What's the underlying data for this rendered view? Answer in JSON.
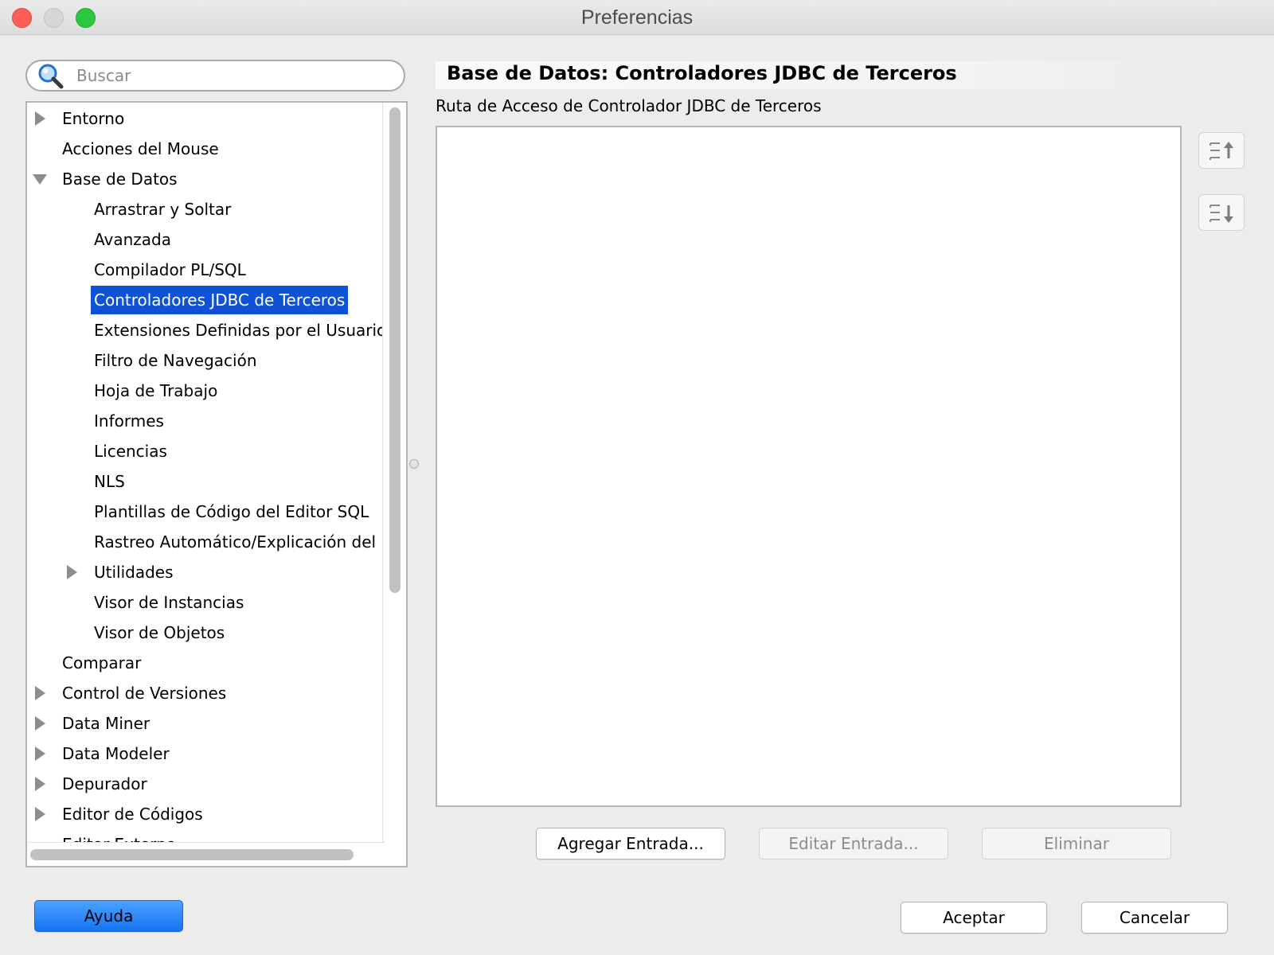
{
  "window": {
    "title": "Preferencias",
    "controls": [
      "close",
      "minimize",
      "maximize"
    ]
  },
  "search": {
    "placeholder": "Buscar",
    "value": "",
    "icon": "magnifier-icon"
  },
  "tree": {
    "items": [
      {
        "label": "Entorno",
        "level": 0,
        "expandable": true,
        "expanded": false
      },
      {
        "label": "Acciones del Mouse",
        "level": 0,
        "expandable": false
      },
      {
        "label": "Base de Datos",
        "level": 0,
        "expandable": true,
        "expanded": true
      },
      {
        "label": "Arrastrar y Soltar",
        "level": 1,
        "expandable": false
      },
      {
        "label": "Avanzada",
        "level": 1,
        "expandable": false
      },
      {
        "label": "Compilador PL/SQL",
        "level": 1,
        "expandable": false
      },
      {
        "label": "Controladores JDBC de Terceros",
        "level": 1,
        "expandable": false,
        "selected": true
      },
      {
        "label": "Extensiones Definidas por el Usuario",
        "level": 1,
        "expandable": false
      },
      {
        "label": "Filtro de Navegación",
        "level": 1,
        "expandable": false
      },
      {
        "label": "Hoja de Trabajo",
        "level": 1,
        "expandable": false
      },
      {
        "label": "Informes",
        "level": 1,
        "expandable": false
      },
      {
        "label": "Licencias",
        "level": 1,
        "expandable": false
      },
      {
        "label": "NLS",
        "level": 1,
        "expandable": false
      },
      {
        "label": "Plantillas de Código del Editor SQL",
        "level": 1,
        "expandable": false
      },
      {
        "label": "Rastreo Automático/Explicación del P",
        "level": 1,
        "expandable": false
      },
      {
        "label": "Utilidades",
        "level": 1,
        "expandable": true,
        "expanded": false
      },
      {
        "label": "Visor de Instancias",
        "level": 1,
        "expandable": false
      },
      {
        "label": "Visor de Objetos",
        "level": 1,
        "expandable": false
      },
      {
        "label": "Comparar",
        "level": 0,
        "expandable": false
      },
      {
        "label": "Control de Versiones",
        "level": 0,
        "expandable": true,
        "expanded": false
      },
      {
        "label": "Data Miner",
        "level": 0,
        "expandable": true,
        "expanded": false
      },
      {
        "label": "Data Modeler",
        "level": 0,
        "expandable": true,
        "expanded": false
      },
      {
        "label": "Depurador",
        "level": 0,
        "expandable": true,
        "expanded": false
      },
      {
        "label": "Editor de Códigos",
        "level": 0,
        "expandable": true,
        "expanded": false
      },
      {
        "label": "Editor Externo",
        "level": 0,
        "expandable": false
      }
    ]
  },
  "content": {
    "title": "Base de Datos: Controladores JDBC de Terceros",
    "path_label": "Ruta de Acceso de Controlador JDBC de Terceros",
    "paths": [],
    "move_up_icon": "move-up-icon",
    "move_down_icon": "move-down-icon",
    "add_label": "Agregar Entrada...",
    "edit_label": "Editar Entrada...",
    "remove_label": "Eliminar"
  },
  "footer": {
    "help_label": "Ayuda",
    "ok_label": "Aceptar",
    "cancel_label": "Cancelar"
  },
  "colors": {
    "selection": "#0f52d6",
    "primary_button": "#1572f2",
    "window_bg": "#ececec"
  }
}
